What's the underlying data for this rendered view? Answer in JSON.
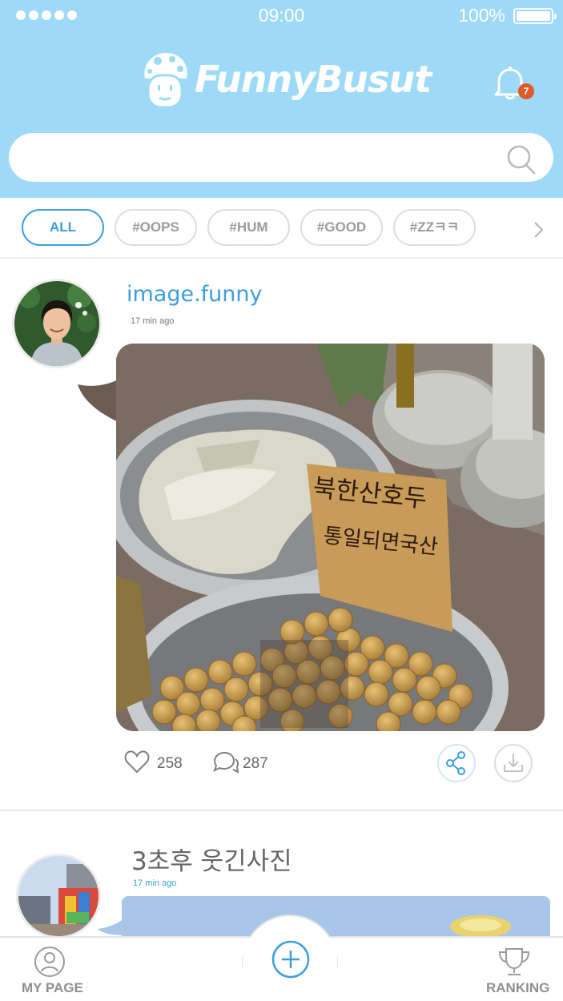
{
  "status_bar": {
    "time": "09:00",
    "battery": "100%"
  },
  "header": {
    "app_name": "FunnyBusut",
    "notification_count": "7"
  },
  "search": {
    "placeholder": ""
  },
  "tags": [
    "ALL",
    "#OOPS",
    "#HUM",
    "#GOOD",
    "#ZZㅋㅋ"
  ],
  "posts": [
    {
      "username": "image.funny",
      "time": "17 min ago",
      "sign_line1": "북한산호두",
      "sign_line2": "통일되면국산",
      "likes": "258",
      "comments": "287"
    },
    {
      "title": "3초후 웃긴사진",
      "time": "17 min ago"
    }
  ],
  "bottom_nav": {
    "my_page": "MY PAGE",
    "ranking": "RANKING"
  },
  "colors": {
    "header": "#9edaf8",
    "accent": "#3c9ee0",
    "badge": "#e35a2a"
  }
}
